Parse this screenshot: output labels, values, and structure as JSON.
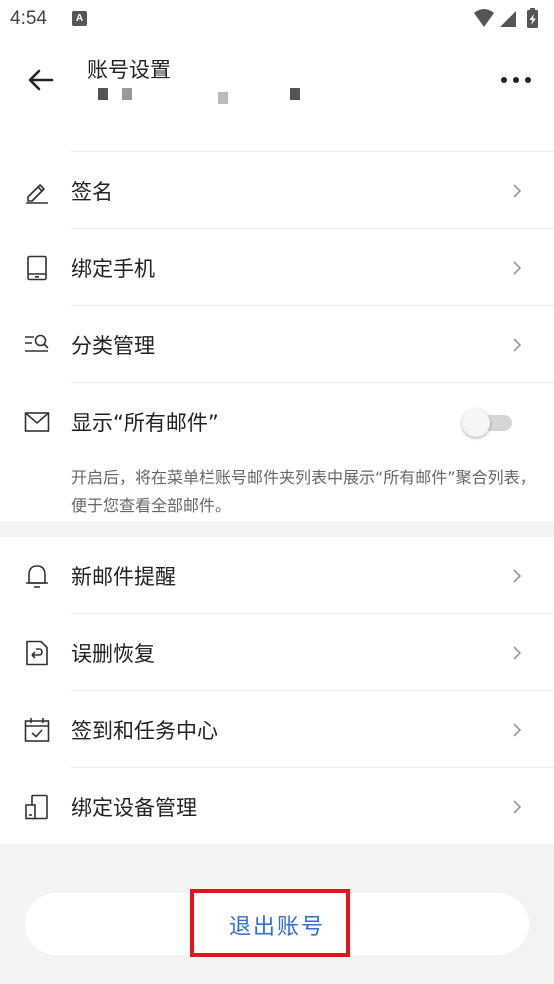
{
  "status_bar": {
    "time": "4:54",
    "app_icon_letter": "A",
    "icons": [
      "wifi-icon",
      "signal-icon",
      "battery-charging-icon"
    ]
  },
  "header": {
    "title": "账号设置",
    "back_icon": "back-arrow-icon",
    "more_icon": "more-horizontal-icon"
  },
  "settings_group_1": [
    {
      "label": "签名",
      "icon": "pen-icon",
      "action": "chevron-right-icon"
    },
    {
      "label": "绑定手机",
      "icon": "phone-icon",
      "action": "chevron-right-icon"
    },
    {
      "label": "分类管理",
      "icon": "list-search-icon",
      "action": "chevron-right-icon"
    },
    {
      "label": "显示“所有邮件”",
      "icon": "envelope-icon",
      "action": "toggle",
      "toggle_on": false
    }
  ],
  "show_all_mail_description": "开启后，将在菜单栏账号邮件夹列表中展示“所有邮件”聚合列表，便于您查看全部邮件。",
  "settings_group_2": [
    {
      "label": "新邮件提醒",
      "icon": "bell-icon",
      "action": "chevron-right-icon"
    },
    {
      "label": "误删恢复",
      "icon": "restore-icon",
      "action": "chevron-right-icon"
    },
    {
      "label": "签到和任务中心",
      "icon": "calendar-check-icon",
      "action": "chevron-right-icon"
    },
    {
      "label": "绑定设备管理",
      "icon": "device-icon",
      "action": "chevron-right-icon"
    }
  ],
  "logout_button": {
    "label": "退出账号"
  },
  "colors": {
    "accent": "#2e6fd6",
    "highlight": "#e8141b",
    "background_gap": "#f3f3f3"
  }
}
